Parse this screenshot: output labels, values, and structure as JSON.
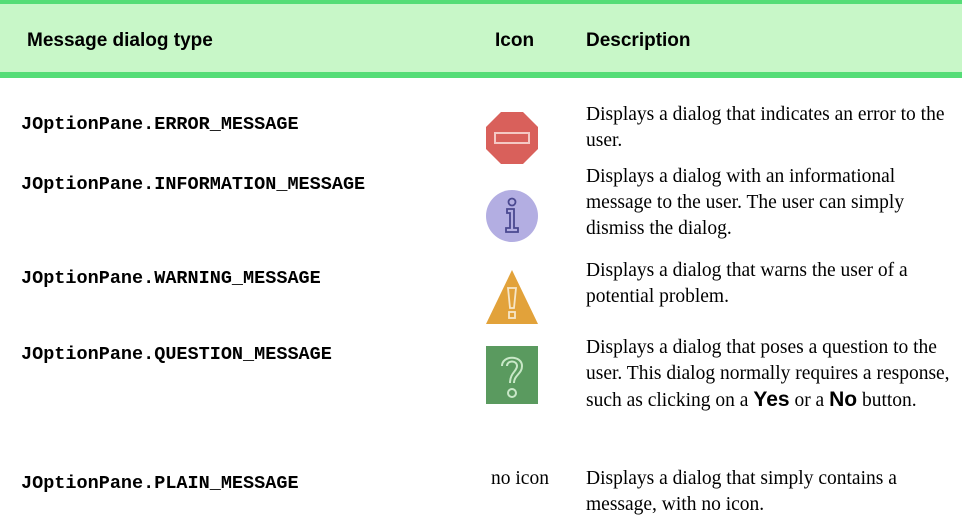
{
  "table": {
    "headers": {
      "type": "Message dialog type",
      "icon": "Icon",
      "description": "Description"
    },
    "rows": [
      {
        "type": "JOptionPane.ERROR_MESSAGE",
        "icon": "error-stop-icon",
        "description": "Displays a dialog that indicates an error to the user."
      },
      {
        "type": "JOptionPane.INFORMATION_MESSAGE",
        "icon": "information-icon",
        "description": "Displays a dialog with an informational message to the user. The user can simply dismiss the dialog."
      },
      {
        "type": "JOptionPane.WARNING_MESSAGE",
        "icon": "warning-icon",
        "description": "Displays a dialog that warns the user of a potential problem."
      },
      {
        "type": "JOptionPane.QUESTION_MESSAGE",
        "icon": "question-icon",
        "description_part1": "Displays a dialog that poses a question to the user. This dialog normally requires a response, such as clicking on a",
        "button_yes": "Yes",
        "description_part2": "or a",
        "button_no": "No",
        "description_part3": "button."
      },
      {
        "type": "JOptionPane.PLAIN_MESSAGE",
        "icon_text": "no icon",
        "description": "Displays a dialog that simply contains a message, with no icon."
      }
    ]
  },
  "colors": {
    "header_bg": "#c8f7c8",
    "header_rule": "#55dd77",
    "error_icon": "#d9605b",
    "info_icon": "#b3aee2",
    "warning_icon": "#e2a23a",
    "question_icon": "#5a9a5f"
  }
}
